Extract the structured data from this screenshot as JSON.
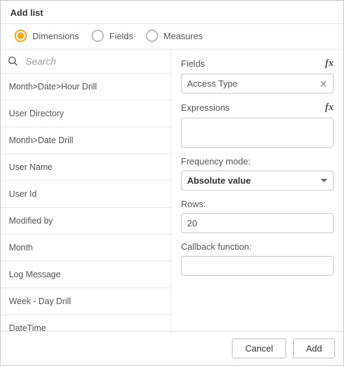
{
  "header": {
    "title": "Add list"
  },
  "tabs": {
    "items": [
      {
        "label": "Dimensions",
        "selected": true
      },
      {
        "label": "Fields",
        "selected": false
      },
      {
        "label": "Measures",
        "selected": false
      }
    ]
  },
  "search": {
    "placeholder": "Search"
  },
  "list": {
    "items": [
      "Month>Date>Hour Drill",
      "User Directory",
      "Month>Date Drill",
      "User Name",
      "User Id",
      "Modified by",
      "Month",
      "Log Message",
      "Week - Day Drill",
      "DateTime"
    ]
  },
  "form": {
    "fields_label": "Fields",
    "fields_value": "Access Type",
    "expressions_label": "Expressions",
    "expressions_value": "",
    "frequency_label": "Frequency mode:",
    "frequency_value": "Absolute value",
    "rows_label": "Rows:",
    "rows_value": "20",
    "callback_label": "Callback function:",
    "callback_value": ""
  },
  "footer": {
    "cancel": "Cancel",
    "add": "Add"
  },
  "icons": {
    "fx": "fx"
  }
}
